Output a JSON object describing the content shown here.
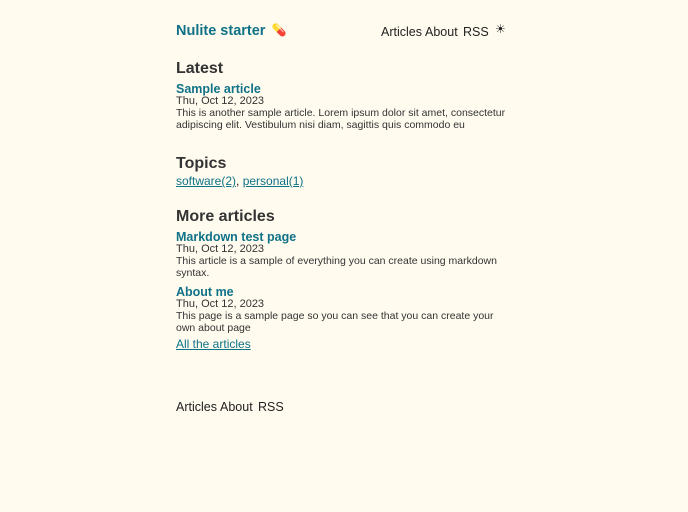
{
  "header": {
    "site_title": "Nulite starter",
    "site_icon": "💊",
    "nav": [
      "Articles",
      "About",
      "RSS"
    ],
    "theme_toggle_icon": "☀"
  },
  "latest": {
    "heading": "Latest",
    "article": {
      "title": "Sample article",
      "date": "Thu, Oct 12, 2023",
      "summary": "This is another sample article. Lorem ipsum dolor sit amet, consectetur adipiscing elit. Vestibulum nisi diam, sagittis quis commodo eu"
    }
  },
  "topics": {
    "heading": "Topics",
    "items": [
      "software(2)",
      "personal(1)"
    ],
    "separator": ", "
  },
  "more": {
    "heading": "More articles",
    "articles": [
      {
        "title": "Markdown test page",
        "date": "Thu, Oct 12, 2023",
        "summary": "This article is a sample of everything you can create using markdown syntax."
      },
      {
        "title": "About me",
        "date": "Thu, Oct 12, 2023",
        "summary": "This page is a sample page so you can see that you can create your own about page"
      }
    ],
    "all_link": "All the articles"
  },
  "footer": {
    "nav": [
      "Articles",
      "About",
      "RSS"
    ]
  },
  "colors": {
    "background": "#fffbef",
    "accent": "#0f7287",
    "text": "#222222"
  }
}
